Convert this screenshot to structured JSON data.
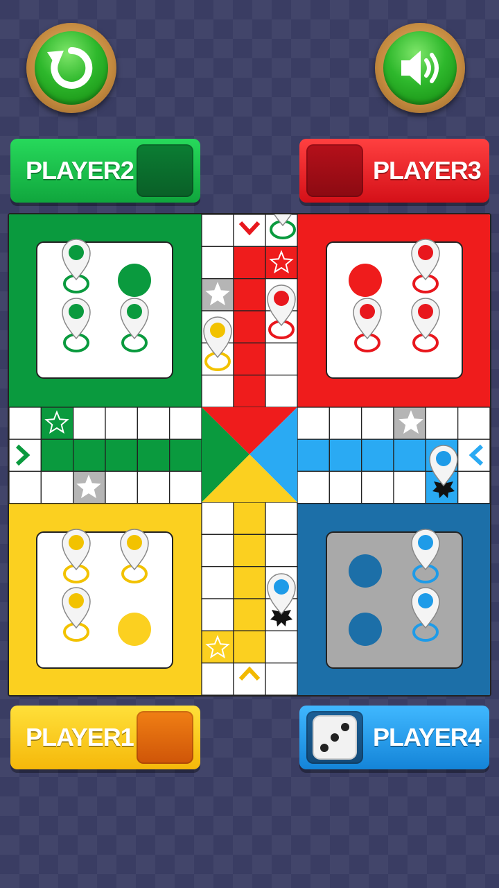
{
  "controls": {
    "undo_icon": "restart-icon",
    "sound_icon": "speaker-icon"
  },
  "players": {
    "player1": {
      "label": "PLAYER1",
      "color": "#f7c51e"
    },
    "player2": {
      "label": "PLAYER2",
      "color": "#12b44a"
    },
    "player3": {
      "label": "PLAYER3",
      "color": "#e8171d"
    },
    "player4": {
      "label": "PLAYER4",
      "color": "#1e9be8"
    }
  },
  "dice": {
    "value": 3
  },
  "colors": {
    "green": "#0a9a3e",
    "red": "#ef1c1c",
    "yellow": "#fbd020",
    "blue": "#2aaaf3",
    "blue_home": "#1c6fa8",
    "safe_grey": "#b5b5b5"
  }
}
